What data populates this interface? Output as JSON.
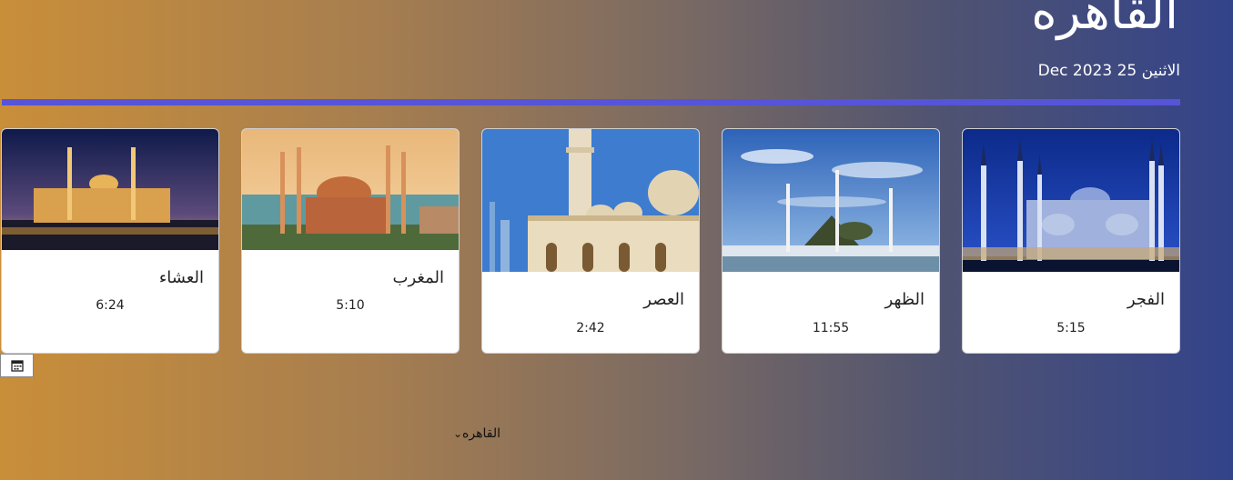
{
  "header": {
    "city": "القاهره",
    "date": "الاثنين 25 Dec 2023"
  },
  "prayers": [
    {
      "name": "الفجر",
      "time": "5:15"
    },
    {
      "name": "الظهر",
      "time": "11:55"
    },
    {
      "name": "العصر",
      "time": "2:42"
    },
    {
      "name": "المغرب",
      "time": "5:10"
    },
    {
      "name": "العشاء",
      "time": "6:24"
    }
  ],
  "city_select": {
    "selected": "القاهره"
  },
  "icons": {
    "calendar": "calendar-icon",
    "dropdown": "chevron-down-icon"
  },
  "colors": {
    "accent": "#5654d8",
    "gradient_start": "#c98e3a",
    "gradient_end": "#33438a"
  }
}
